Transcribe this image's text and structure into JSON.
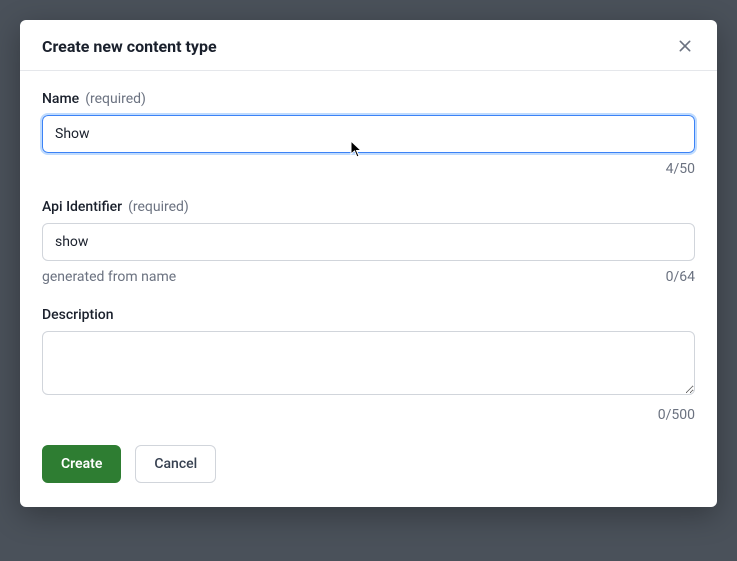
{
  "modal": {
    "title": "Create new content type"
  },
  "fields": {
    "name": {
      "label": "Name",
      "required": "(required)",
      "value": "Show",
      "counter": "4/50"
    },
    "apiIdentifier": {
      "label": "Api Identifier",
      "required": "(required)",
      "value": "show",
      "helper": "generated from name",
      "counter": "0/64"
    },
    "description": {
      "label": "Description",
      "value": "",
      "counter": "0/500"
    }
  },
  "buttons": {
    "create": "Create",
    "cancel": "Cancel"
  }
}
